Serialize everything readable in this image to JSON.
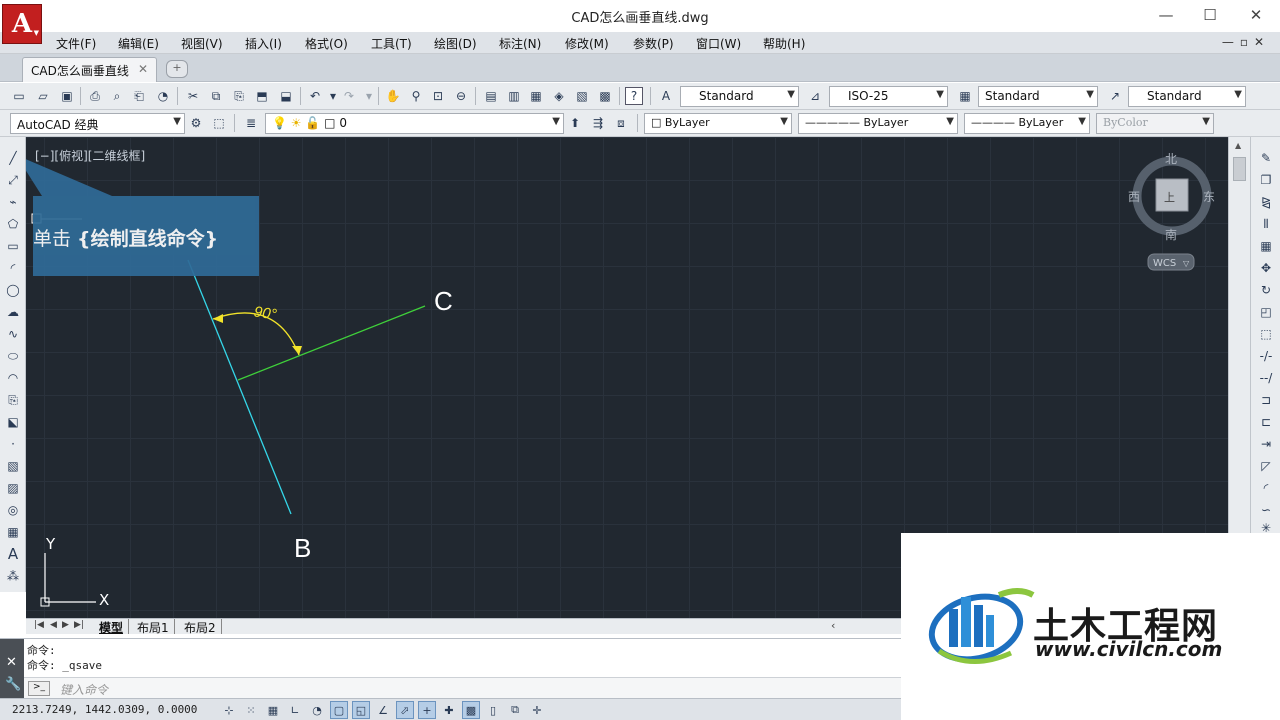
{
  "window": {
    "title": "CAD怎么画垂直线.dwg",
    "logo": "A",
    "controls": {
      "minimize": "—",
      "maximize": "☐",
      "close": "✕"
    }
  },
  "menu": {
    "items": [
      "文件(F)",
      "编辑(E)",
      "视图(V)",
      "插入(I)",
      "格式(O)",
      "工具(T)",
      "绘图(D)",
      "标注(N)",
      "修改(M)",
      "参数(P)",
      "窗口(W)",
      "帮助(H)"
    ],
    "mdi_controls": "—▫✕"
  },
  "doc_tab": {
    "label": "CAD怎么画垂直线",
    "close": "✕",
    "new_tab": "+"
  },
  "toolbar1": {
    "text_style": "Standard",
    "dim_style": "ISO-25",
    "table_style": "Standard",
    "multileader_style": "Standard"
  },
  "toolbar2": {
    "workspace": "AutoCAD 经典",
    "layer": "0",
    "color": "ByLayer",
    "linetype": "ByLayer",
    "lineweight": "ByLayer",
    "plotstyle": "ByColor"
  },
  "viewport": {
    "label": "[−][俯视][二维线框]",
    "tooltip_plain": "单击 ",
    "tooltip_bold": "{绘制直线命令}",
    "angle_label": "90°",
    "point_c": "C",
    "point_b": "B"
  },
  "viewcube": {
    "north": "北",
    "south": "南",
    "east": "东",
    "west": "西",
    "face": "上",
    "ucs_label": "WCS"
  },
  "ucs_icon": {
    "x": "X",
    "y": "Y"
  },
  "layout_tabs": [
    "模型",
    "布局1",
    "布局2"
  ],
  "command": {
    "line1": "命令:",
    "line2": "命令: _qsave",
    "placeholder": "键入命令"
  },
  "status": {
    "coordinates": "2213.7249, 1442.0309, 0.0000"
  },
  "watermark": {
    "title": "土木工程网",
    "url": "www.civilcn.com"
  },
  "colors": {
    "canvas_bg": "#212830",
    "line_cyan": "#35d6e8",
    "line_green": "#3fd13a",
    "dimension_yellow": "#f2e32a",
    "callout_bg": "#2f6b97"
  },
  "icons": {
    "left_toolbar": [
      "line-icon",
      "construction-line-icon",
      "polyline-icon",
      "polygon-icon",
      "rectangle-icon",
      "arc-icon",
      "circle-icon",
      "revision-cloud-icon",
      "spline-icon",
      "ellipse-icon",
      "ellipse-arc-icon",
      "insert-block-icon",
      "make-block-icon",
      "point-icon",
      "hatch-icon",
      "gradient-icon",
      "region-icon",
      "table-icon",
      "multiline-text-icon",
      "add-selected-icon"
    ],
    "right_toolbar": [
      "erase-icon",
      "copy-icon",
      "mirror-icon",
      "offset-icon",
      "array-icon",
      "move-icon",
      "rotate-icon",
      "scale-icon",
      "stretch-icon",
      "trim-icon",
      "extend-icon",
      "break-at-point-icon",
      "break-icon",
      "join-icon",
      "chamfer-icon",
      "fillet-icon",
      "blend-icon",
      "explode-icon"
    ]
  }
}
